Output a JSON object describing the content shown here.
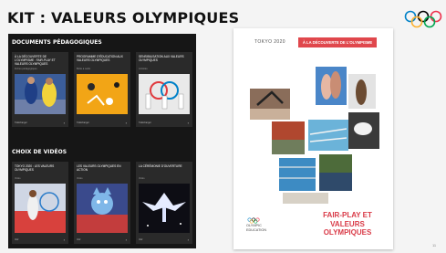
{
  "slide": {
    "title": "KIT : VALEURS OLYMPIQUES",
    "page_number": "11"
  },
  "left_panel": {
    "section1_title": "DOCUMENTS PÉDAGOGIQUES",
    "section2_title": "CHOIX DE VIDÉOS",
    "docs": [
      {
        "title": "À LA DÉCOUVERTE DE L'OLYMPISME : FAIR-PLAY ET VALEURS OLYMPIQUES",
        "sub": "Fiches pédagogiques",
        "foot": "Télécharger"
      },
      {
        "title": "PROGRAMME D'ÉDUCATION AUX VALEURS OLYMPIQUES",
        "sub": "Boîte à outils",
        "foot": "Télécharger"
      },
      {
        "title": "SENSIBILISATION AUX VALEURS OLYMPIQUES",
        "sub": "Activités",
        "foot": "Télécharger"
      }
    ],
    "videos": [
      {
        "title": "TOKYO 2020 : LES VALEURS OLYMPIQUES",
        "sub": "Vidéo",
        "foot": "Voir"
      },
      {
        "title": "LES VALEURS OLYMPIQUES EN ACTION",
        "sub": "Vidéo",
        "foot": "Voir"
      },
      {
        "title": "LA CÉRÉMONIE D'OUVERTURE",
        "sub": "Vidéo",
        "foot": "Voir"
      }
    ]
  },
  "cover": {
    "logo": "TOKYO 2020",
    "banner": "À LA DÉCOUVERTE DE L'OLYMPISME",
    "title_line1": "FAIR-PLAY ET",
    "title_line2": "VALEURS OLYMPIQUES",
    "edu_line1": "OLYMPIC",
    "edu_line2": "EDUCATION"
  },
  "colors": {
    "accent_red": "#d93a47",
    "ring_blue": "#0081c8",
    "ring_yellow": "#fcb131",
    "ring_black": "#000000",
    "ring_green": "#00a651",
    "ring_red": "#ee334e"
  }
}
